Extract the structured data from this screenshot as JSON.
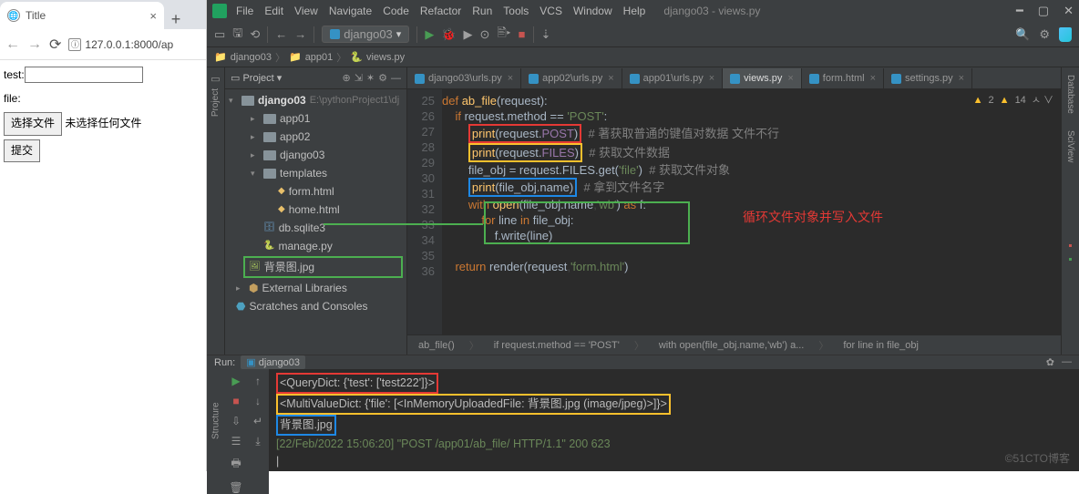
{
  "browser": {
    "tab_title": "Title",
    "url": "127.0.0.1:8000/ap",
    "form": {
      "test_label": "test:",
      "file_label": "file:",
      "choose_btn": "选择文件",
      "no_file": "未选择任何文件",
      "submit": "提交"
    }
  },
  "ide": {
    "title": "django03 - views.py",
    "menu": [
      "File",
      "Edit",
      "View",
      "Navigate",
      "Code",
      "Refactor",
      "Run",
      "Tools",
      "VCS",
      "Window",
      "Help"
    ],
    "run_config": "django03",
    "crumbs": [
      "django03",
      "app01",
      "views.py"
    ],
    "project": {
      "header": "Project",
      "root": "django03",
      "root_path": "E:\\pythonProject1\\dj",
      "items": [
        {
          "name": "app01",
          "type": "folder",
          "expand": ">",
          "depth": 1
        },
        {
          "name": "app02",
          "type": "folder",
          "expand": ">",
          "depth": 1
        },
        {
          "name": "django03",
          "type": "folder",
          "expand": ">",
          "depth": 1
        },
        {
          "name": "templates",
          "type": "folder",
          "expand": "v",
          "depth": 1
        },
        {
          "name": "form.html",
          "type": "html",
          "depth": 2
        },
        {
          "name": "home.html",
          "type": "html",
          "depth": 2
        },
        {
          "name": "db.sqlite3",
          "type": "db",
          "depth": 1
        },
        {
          "name": "manage.py",
          "type": "py",
          "depth": 1
        },
        {
          "name": "背景图.jpg",
          "type": "img",
          "depth": 1,
          "selected": true
        },
        {
          "name": "External Libraries",
          "type": "lib",
          "expand": ">",
          "depth": 0
        },
        {
          "name": "Scratches and Consoles",
          "type": "scratch",
          "depth": 0
        }
      ]
    },
    "tabs": [
      {
        "label": "django03\\urls.py"
      },
      {
        "label": "app02\\urls.py"
      },
      {
        "label": "app01\\urls.py"
      },
      {
        "label": "views.py",
        "active": true
      },
      {
        "label": "form.html"
      },
      {
        "label": "settings.py"
      }
    ],
    "warnings": {
      "a": "2",
      "b": "14"
    },
    "code": {
      "start": 25,
      "lines": [
        "",
        "def ab_file(request):",
        "    if request.method == 'POST':",
        "        print(request.POST)  # 著获取普通的键值对数据 文件不行",
        "        print(request.FILES)  # 获取文件数据",
        "        file_obj = request.FILES.get('file')  # 获取文件对象",
        "        print(file_obj.name)  # 拿到文件名字",
        "        with open(file_obj.name,'wb') as f:",
        "            for line in file_obj:",
        "                f.write(line)",
        "",
        "    return render(request,'form.html')"
      ]
    },
    "annotation": "循环文件对象并写入文件",
    "breadcrumb2": [
      "ab_file()",
      "if request.method == 'POST'",
      "with open(file_obj.name,'wb') a...",
      "for line in file_obj"
    ],
    "run": {
      "label": "Run:",
      "name": "django03",
      "out1": "<QueryDict: {'test': ['test222']}>",
      "out2": "<MultiValueDict: {'file': [<InMemoryUploadedFile: 背景图.jpg (image/jpeg)>]}>",
      "out3": "背景图.jpg",
      "out4": "[22/Feb/2022 15:06:20] \"POST /app01/ab_file/ HTTP/1.1\" 200 623",
      "cursor": "|"
    },
    "left_tool": "Project",
    "right_tools": [
      "Database",
      "SciView"
    ],
    "bottom_tool": "Structure",
    "watermark": "©51CTO博客"
  }
}
